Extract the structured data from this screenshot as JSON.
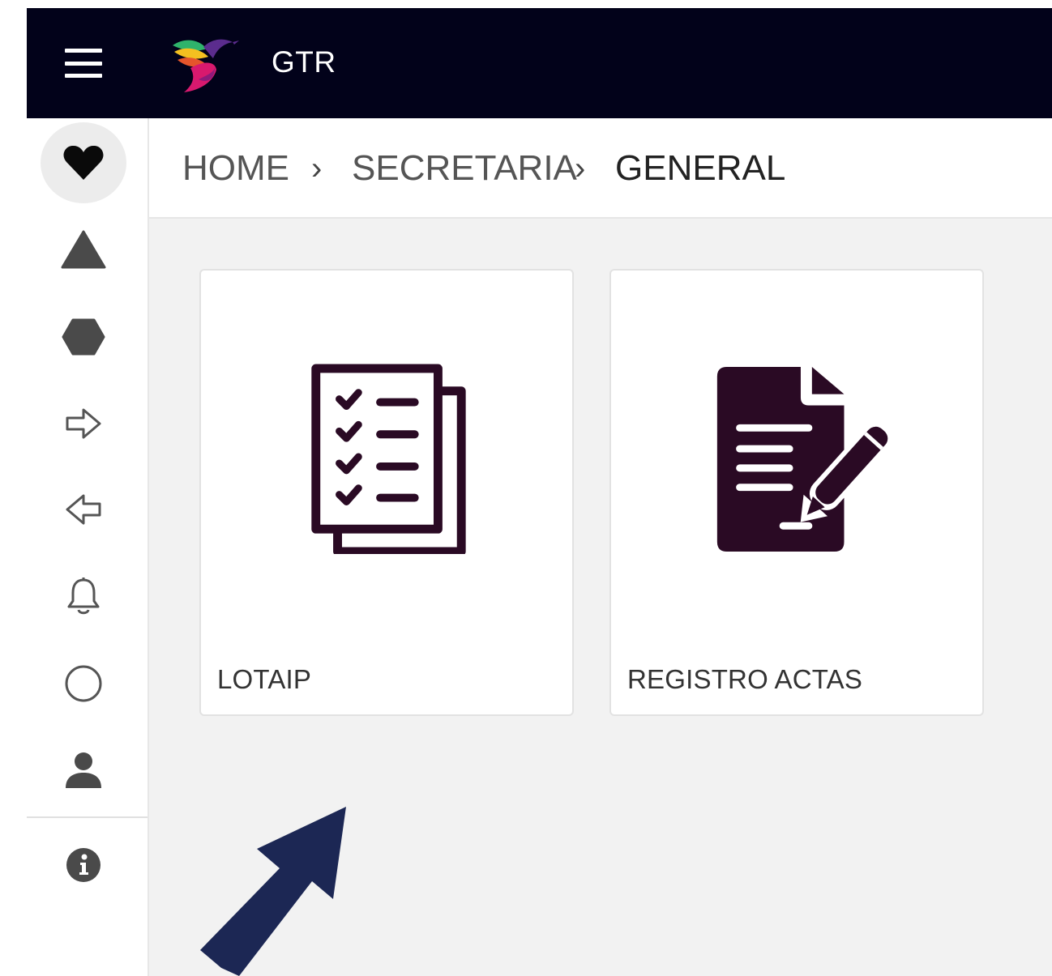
{
  "header": {
    "title": "GTR",
    "menu_icon": "hamburger-menu-icon",
    "logo_icon": "hummingbird-logo",
    "background": "#02021a"
  },
  "sidebar": {
    "items": [
      {
        "icon": "heart-icon",
        "active": true
      },
      {
        "icon": "triangle-icon",
        "active": false
      },
      {
        "icon": "hexagon-icon",
        "active": false
      },
      {
        "icon": "arrow-right-outline-icon",
        "active": false
      },
      {
        "icon": "arrow-left-outline-icon",
        "active": false
      },
      {
        "icon": "bell-icon",
        "active": false
      },
      {
        "icon": "circle-icon",
        "active": false
      },
      {
        "icon": "user-icon",
        "active": false
      },
      {
        "icon": "info-icon",
        "active": false
      }
    ]
  },
  "breadcrumb": {
    "items": [
      "HOME",
      "SECRETARIA",
      "GENERAL"
    ],
    "separator": "›"
  },
  "cards": [
    {
      "label": "LOTAIP",
      "icon": "checklist-documents-icon"
    },
    {
      "label": "REGISTRO ACTAS",
      "icon": "document-signature-icon"
    }
  ],
  "colors": {
    "icon_dark": "#2a0a24",
    "annotation_arrow": "#1c2754"
  }
}
